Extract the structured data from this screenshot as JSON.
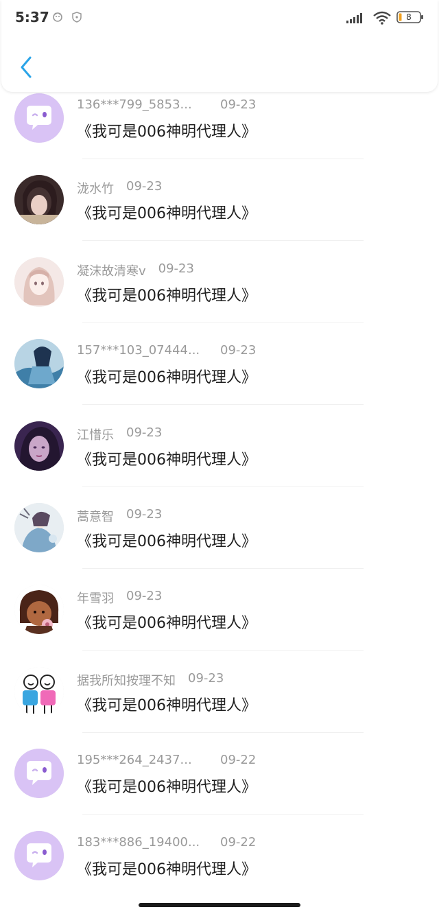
{
  "status_bar": {
    "time": "5:37",
    "battery_level": "8",
    "icons": [
      "notification-app-icon",
      "shield-icon",
      "signal-icon",
      "wifi-icon",
      "battery-icon"
    ]
  },
  "header": {
    "back_icon": "chevron-left-icon",
    "accent_color": "#2aa4e8"
  },
  "items": [
    {
      "name": "136***799_5853...",
      "date": "09-23",
      "text": "《我可是006神明代理人》",
      "avatar": "default-chat-avatar"
    },
    {
      "name": "泷水竹",
      "date": "09-23",
      "text": "《我可是006神明代理人》",
      "avatar": "photo-avatar"
    },
    {
      "name": "凝沫故清寒v",
      "date": "09-23",
      "text": "《我可是006神明代理人》",
      "avatar": "anime-girl-avatar"
    },
    {
      "name": "157***103_07444...",
      "date": "09-23",
      "text": "《我可是006神明代理人》",
      "avatar": "anime-blue-avatar"
    },
    {
      "name": "江惜乐",
      "date": "09-23",
      "text": "《我可是006神明代理人》",
      "avatar": "dark-portrait-avatar"
    },
    {
      "name": "蒿意智",
      "date": "09-23",
      "text": "《我可是006神明代理人》",
      "avatar": "anime-illustration-avatar"
    },
    {
      "name": "年雪羽",
      "date": "09-23",
      "text": "《我可是006神明代理人》",
      "avatar": "cartoon-character-avatar"
    },
    {
      "name": "据我所知按理不知",
      "date": "09-23",
      "text": "《我可是006神明代理人》",
      "avatar": "cartoon-couple-avatar"
    },
    {
      "name": "195***264_2437...",
      "date": "09-22",
      "text": "《我可是006神明代理人》",
      "avatar": "default-chat-avatar"
    },
    {
      "name": "183***886_19400...",
      "date": "09-22",
      "text": "《我可是006神明代理人》",
      "avatar": "default-chat-avatar"
    }
  ]
}
